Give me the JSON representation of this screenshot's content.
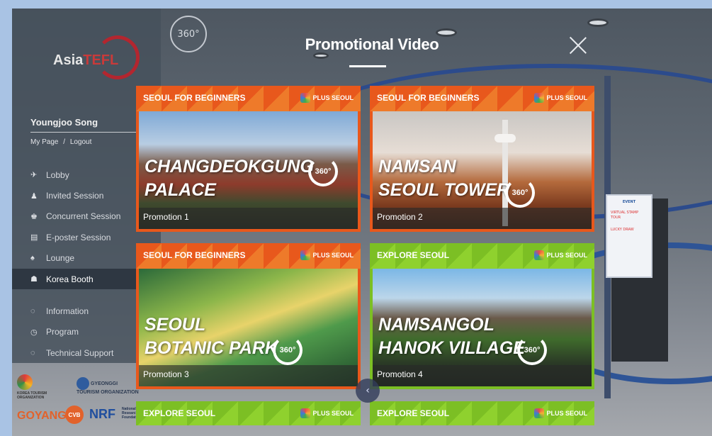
{
  "app": {
    "logo_primary": "Asia",
    "logo_secondary": "TEFL"
  },
  "user": {
    "name": "Youngjoo Song",
    "my_page": "My Page",
    "separator": "/",
    "logout": "Logout"
  },
  "menu": {
    "items": [
      {
        "label": "Lobby",
        "icon": "airplane-icon",
        "active": false
      },
      {
        "label": "Invited Session",
        "icon": "person-icon",
        "active": false
      },
      {
        "label": "Concurrent Session",
        "icon": "people-icon",
        "active": false
      },
      {
        "label": "E-poster Session",
        "icon": "poster-icon",
        "active": false
      },
      {
        "label": "Lounge",
        "icon": "bell-icon",
        "active": false
      },
      {
        "label": "Korea Booth",
        "icon": "booth-icon",
        "active": true
      }
    ],
    "secondary": [
      {
        "label": "Information",
        "icon": "chat-icon"
      },
      {
        "label": "Program",
        "icon": "clock-icon"
      },
      {
        "label": "Technical Support",
        "icon": "support-icon"
      }
    ]
  },
  "sponsors": {
    "kto": "KOREA TOURISM ORGANIZATION",
    "gyeonggi": "GYEONGGI TOURISM ORGANIZATION",
    "goyang": "GOYANG",
    "cvb": "CVB",
    "nrf": "NRF",
    "nrf_sub": "National Research Foundation"
  },
  "scene": {
    "view_360_label": "360°",
    "event_panel_title": "EVENT",
    "event_items": [
      "VIRTUAL STAMP TOUR",
      "LUCKY DRAW"
    ]
  },
  "modal": {
    "title": "Promotional Video",
    "cards": [
      {
        "category": "SEOUL FOR BEGINNERS",
        "brand": "PLUS SEOUL",
        "title_line1": "CHANGDEOKGUNG",
        "title_line2": "PALACE",
        "badge": "360°",
        "caption": "Promotion 1",
        "color": "#e8581c"
      },
      {
        "category": "SEOUL FOR BEGINNERS",
        "brand": "PLUS SEOUL",
        "title_line1": "NAMSAN",
        "title_line2": "SEOUL TOWER",
        "badge": "360°",
        "caption": "Promotion 2",
        "color": "#e8581c"
      },
      {
        "category": "SEOUL FOR BEGINNERS",
        "brand": "PLUS SEOUL",
        "title_line1": "SEOUL",
        "title_line2": "BOTANIC PARK",
        "badge": "360°",
        "caption": "Promotion 3",
        "color": "#e8581c"
      },
      {
        "category": "EXPLORE SEOUL",
        "brand": "PLUS SEOUL",
        "title_line1": "NAMSANGOL",
        "title_line2": "HANOK VILLAGE",
        "badge": "360°",
        "caption": "Promotion 4",
        "color": "#7cbf24"
      }
    ],
    "next_row": [
      {
        "category": "EXPLORE SEOUL",
        "brand": "PLUS SEOUL"
      },
      {
        "category": "EXPLORE SEOUL",
        "brand": "PLUS SEOUL"
      }
    ],
    "scroll_back_icon": "arrow-left-icon"
  }
}
